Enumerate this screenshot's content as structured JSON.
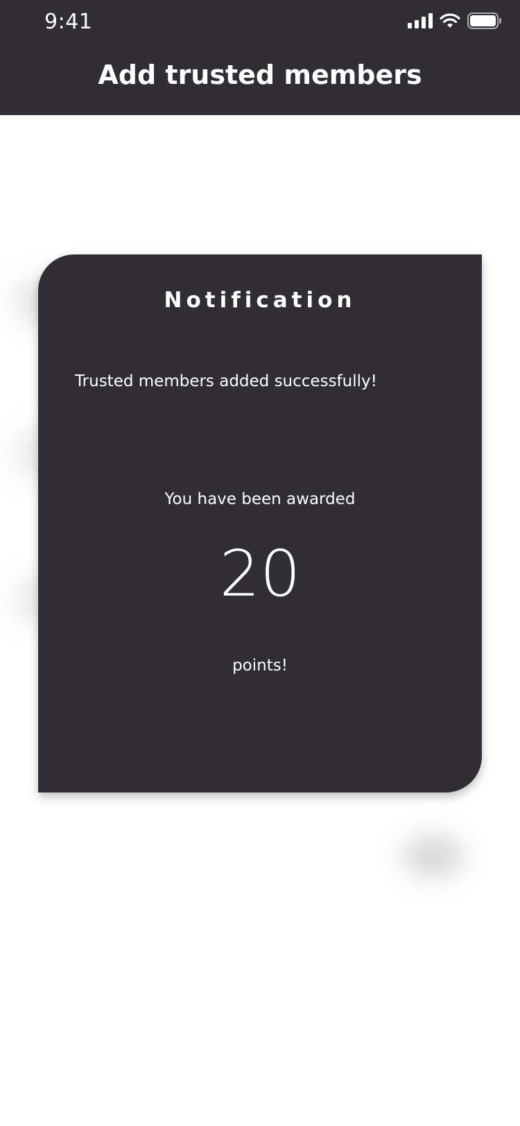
{
  "status_bar": {
    "time": "9:41",
    "icons": [
      "cellular-signal-icon",
      "wifi-icon",
      "battery-icon"
    ]
  },
  "header": {
    "title": "Add trusted members",
    "background": "#302d35"
  },
  "modal": {
    "title": "Notification",
    "message": "Trusted members added successfully!",
    "award_text": "You have been awarded",
    "points": "20",
    "points_suffix": "points!",
    "background": "#302d35",
    "text_color": "#ffffff"
  }
}
